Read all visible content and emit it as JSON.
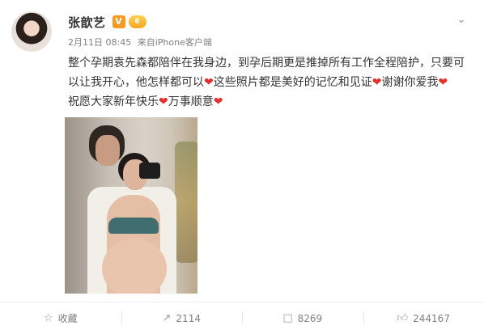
{
  "post": {
    "username": "张歆艺",
    "verified_badge": "V",
    "vip_badge": "6",
    "date": "2月11日 08:45",
    "source_prefix": "来自",
    "source": "iPhone客户端",
    "more_icon": "chevron-down-icon",
    "text": {
      "line1": "整个孕期袁先森都陪伴在我身边，到孕后期更是推掉所有工作全程陪护，只要可",
      "line2_a": "以让我开心，他怎样都可以",
      "line2_b": "这些照片都是美好的记忆和见证",
      "line2_c": "谢谢你爱我",
      "line3_a": "祝愿大家新年快乐",
      "line3_b": "万事顺意",
      "heart": "❤"
    }
  },
  "actions": {
    "favorite_label": "收藏",
    "repost_count": "2114",
    "comment_count": "8269",
    "like_count": "244167"
  },
  "colors": {
    "heart": "#e2312f",
    "text": "#333333",
    "meta": "#808080",
    "badge_verified": "#f59a23"
  }
}
